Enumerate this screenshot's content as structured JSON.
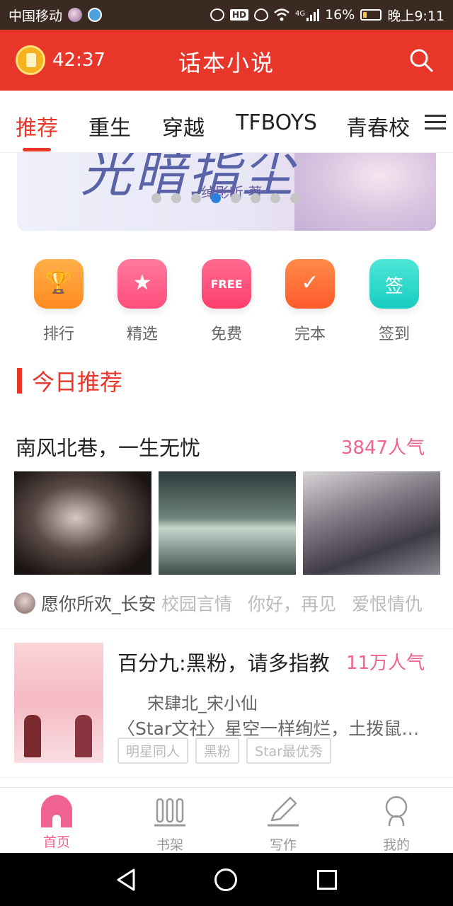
{
  "status_bar": {
    "carrier": "中国移动",
    "hd": "HD",
    "network": "4G",
    "battery": "16%",
    "time": "晚上9:11"
  },
  "header": {
    "timer": "42:37",
    "title": "话本小说",
    "icons": [
      "coin-timer-icon",
      "search-icon"
    ],
    "accent": "#e8372a"
  },
  "tabs": [
    {
      "label": "推荐",
      "active": true
    },
    {
      "label": "重生"
    },
    {
      "label": "穿越"
    },
    {
      "label": "TFBOYS"
    },
    {
      "label": "青春校"
    }
  ],
  "banner": {
    "title": "光暗指尘",
    "author": "绰影昕 著",
    "dots": 8,
    "active_dot": 4
  },
  "quick_menu": [
    {
      "label": "排行",
      "icon": "trophy-icon"
    },
    {
      "label": "精选",
      "icon": "star-icon"
    },
    {
      "label": "免费",
      "icon": "free-icon",
      "badge": "FREE"
    },
    {
      "label": "完本",
      "icon": "check-icon"
    },
    {
      "label": "签到",
      "icon": "sign-in-icon",
      "glyph": "签"
    }
  ],
  "section": {
    "title": "今日推荐"
  },
  "featured": {
    "title": "南风北巷，一生无忧",
    "popularity": "3847人气",
    "author": "愿你所欢_长安",
    "tags": [
      "校园言情",
      "你好，再见",
      "爱恨情仇"
    ]
  },
  "book": {
    "title": "百分九:黑粉，请多指教",
    "popularity": "11万人气",
    "author": "宋肆北_宋小仙",
    "description": "〈Star文社〉星空一样绚烂，土拨鼠一样可爱",
    "tags": [
      "明星同人",
      "黑粉",
      "Star最优秀"
    ]
  },
  "bottom_nav": [
    {
      "label": "首页",
      "active": true
    },
    {
      "label": "书架"
    },
    {
      "label": "写作"
    },
    {
      "label": "我的"
    }
  ],
  "colors": {
    "header_red": "#e8372a",
    "pink": "#f06292",
    "active_dot": "#2b7fe0"
  }
}
